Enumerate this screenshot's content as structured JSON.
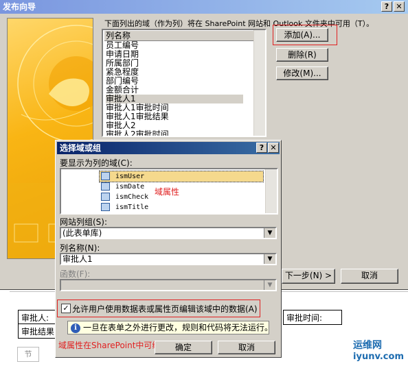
{
  "window": {
    "title": "发布向导",
    "help_label": "?",
    "close_label": "✕"
  },
  "wizard": {
    "instruction": "下面列出的域（作为列）将在 SharePoint 网站和 Outlook 文件夹中可用（T）。",
    "list_header": "列名称",
    "columns": [
      "员工编号",
      "申请日期",
      "所属部门",
      "紧急程度",
      "部门编号",
      "金额合计",
      "审批人1",
      "审批人1审批时间",
      "审批人1审批结果",
      "审批人2",
      "审批人2审批时间"
    ],
    "selected_column": "审批人1",
    "add_button": "添加(A)...",
    "delete_button": "删除(R)",
    "modify_button": "修改(M)...",
    "next_button": "下一步(N) >",
    "cancel_button": "取消"
  },
  "dialog": {
    "title": "选择域或组",
    "help_label": "?",
    "close_label": "✕",
    "fields_label": "要显示为列的域(C):",
    "fields": [
      "ismUser",
      "ismDate",
      "ismCheck",
      "ismTitle"
    ],
    "selected_field": "ismUser",
    "annotation_field_attr": "域属性",
    "site_group_label": "网站列组(S):",
    "site_group_value": "(此表单库)",
    "column_name_label": "列名称(N):",
    "column_name_value": "审批人1",
    "function_label": "函数(F):",
    "function_value": "",
    "allow_edit_label": "允许用户使用数据表或属性页编辑该域中的数据(A)",
    "allow_edit_checked": true,
    "info_text": "一旦在表单之外进行更改，规则和代码将无法运行。",
    "annotation_editable": "域属性在SharePoint中可编辑",
    "ok_button": "确定",
    "cancel_button": "取消"
  },
  "document": {
    "cells": [
      "审批人:",
      "审批时间:",
      "审批结果"
    ],
    "section_tab": "节"
  },
  "watermark": {
    "line1": "运维网",
    "line2": "iyunv.com"
  },
  "colors": {
    "annotation_red": "#e02020",
    "wizard_title_gradient_start": "#7a96df",
    "dialog_title_gradient_start": "#0a246a",
    "highlight": "#f5d98d"
  }
}
